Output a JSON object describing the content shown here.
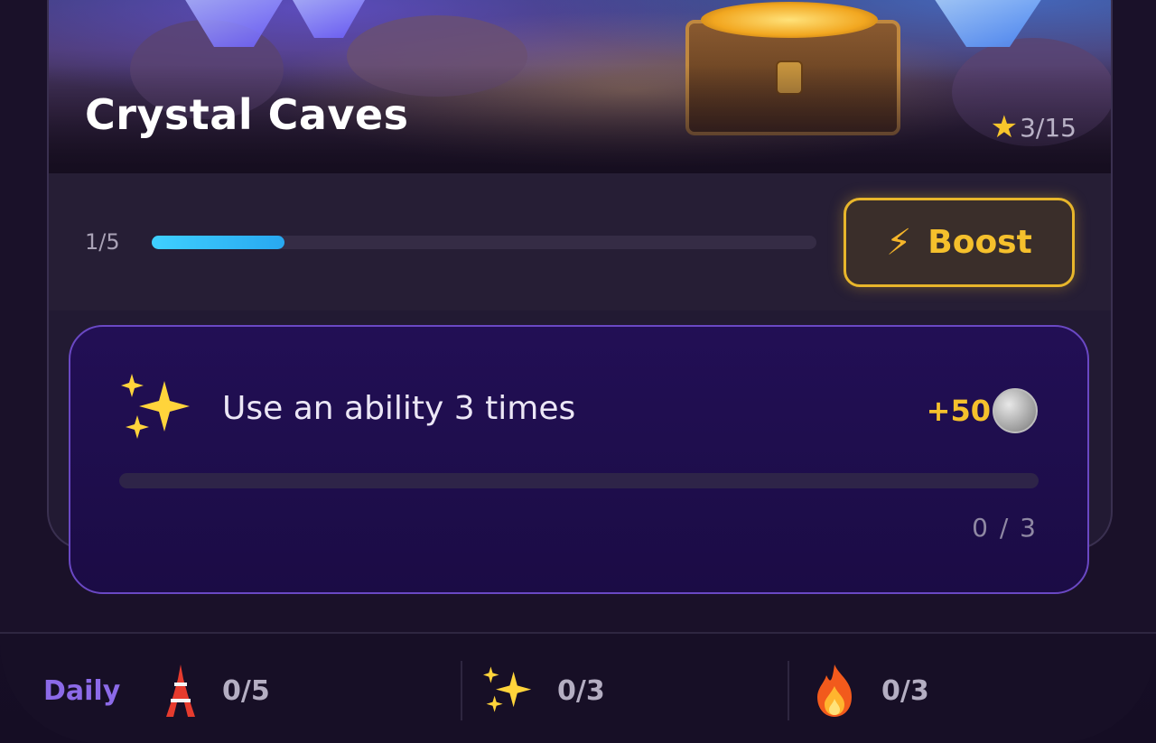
{
  "level": {
    "title": "Crystal Caves",
    "stars": "3/15",
    "progress_label": "1/5",
    "progress_fraction": 0.2,
    "boost_label": "Boost",
    "boost_icon": "lightning-bolt-icon"
  },
  "quest": {
    "icon": "sparkles-icon",
    "title": "Use an ability 3 times",
    "reward": "+50",
    "reward_icon": "silver-coin-icon",
    "progress_fraction": 0,
    "count": "0 / 3"
  },
  "daily": {
    "label": "Daily",
    "items": [
      {
        "icon": "tower-icon",
        "count": "0/5"
      },
      {
        "icon": "sparkles-icon",
        "count": "0/3"
      },
      {
        "icon": "fire-icon",
        "count": "0/3"
      }
    ]
  },
  "colors": {
    "accent_gold": "#f5c02c",
    "progress_blue": "#3fd0ff",
    "quest_border": "#6a48c4",
    "daily_purple": "#8c6ae8"
  }
}
